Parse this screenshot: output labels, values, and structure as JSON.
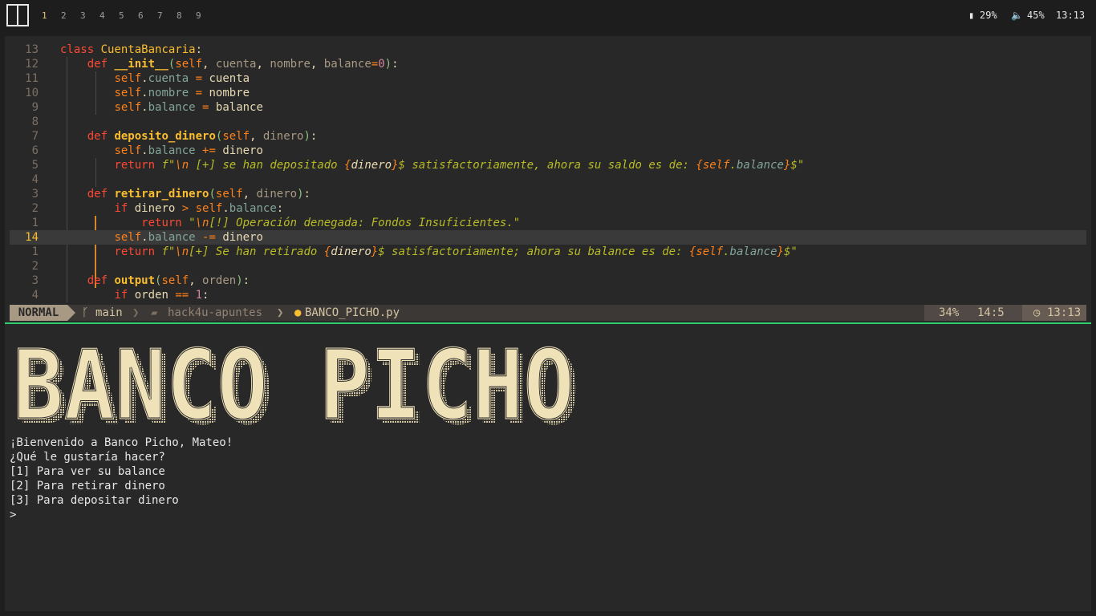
{
  "topbar": {
    "workspaces": [
      "1",
      "2",
      "3",
      "4",
      "5",
      "6",
      "7",
      "8",
      "9"
    ],
    "active_workspace": "1",
    "battery": "29%",
    "volume": "45%",
    "clock": "13:13"
  },
  "editor": {
    "lines": [
      {
        "num": "13",
        "html": "<span class=\"kw\">class</span> <span class=\"cls\">CuentaBancaria</span>:"
      },
      {
        "num": "12",
        "html": "    <span class=\"kw\">def</span> <span class=\"fn\">__init__</span><span class=\"par\">(</span><span class=\"self\">self</span>, <span class=\"param\">cuenta</span>, <span class=\"param\">nombre</span>, <span class=\"param\">balance</span><span class=\"op\">=</span><span class=\"num\">0</span><span class=\"par\">)</span>:"
      },
      {
        "num": "11",
        "html": "        <span class=\"self\">self</span>.<span class=\"attr\">cuenta</span> <span class=\"op\">=</span> cuenta"
      },
      {
        "num": "10",
        "html": "        <span class=\"self\">self</span>.<span class=\"attr\">nombre</span> <span class=\"op\">=</span> nombre"
      },
      {
        "num": "9",
        "html": "        <span class=\"self\">self</span>.<span class=\"attr\">balance</span> <span class=\"op\">=</span> balance"
      },
      {
        "num": "8",
        "html": ""
      },
      {
        "num": "7",
        "html": "    <span class=\"kw\">def</span> <span class=\"fn\">deposito_dinero</span><span class=\"par\">(</span><span class=\"self\">self</span>, <span class=\"param\">dinero</span><span class=\"par\">)</span>:"
      },
      {
        "num": "6",
        "html": "        <span class=\"self\">self</span>.<span class=\"attr\">balance</span> <span class=\"op\">+=</span> dinero"
      },
      {
        "num": "5",
        "html": "        <span class=\"kw\">return</span> <span class=\"str\">f\"<span class=\"esc\">\\n</span> [+] se han depositado <span class=\"brace\">{</span><span class=\"ivar\">dinero</span><span class=\"brace\">}</span>$ satisfactoriamente, ahora su saldo es de: <span class=\"brace\">{</span><span class=\"self\">self</span>.<span class=\"attr\">balance</span><span class=\"brace\">}</span>$\"</span>"
      },
      {
        "num": "4",
        "html": ""
      },
      {
        "num": "3",
        "html": "    <span class=\"kw\">def</span> <span class=\"fn\">retirar_dinero</span><span class=\"par\">(</span><span class=\"self\">self</span>, <span class=\"param\">dinero</span><span class=\"par\">)</span>:"
      },
      {
        "num": "2",
        "html": "        <span class=\"kw\">if</span> dinero <span class=\"op\">&gt;</span> <span class=\"self\">self</span>.<span class=\"attr\">balance</span>:"
      },
      {
        "num": "1",
        "html": "            <span class=\"kw\">return</span> <span class=\"str\">\"<span class=\"esc\">\\n</span>[!] Operación denegada: Fondos Insuficientes.\"</span>"
      },
      {
        "num": "14",
        "html": "        <span class=\"self\">self</span>.<span class=\"attr\">balance</span> <span class=\"op\">-=</span> dinero",
        "current": true
      },
      {
        "num": "1",
        "html": "        <span class=\"kw\">return</span> <span class=\"str\">f\"<span class=\"esc\">\\n</span>[+] Se han retirado <span class=\"brace\">{</span><span class=\"ivar\">dinero</span><span class=\"brace\">}</span>$ satisfactoriamente; ahora su balance es de: <span class=\"brace\">{</span><span class=\"self\">self</span>.<span class=\"attr\">balance</span><span class=\"brace\">}</span>$\"</span>"
      },
      {
        "num": "2",
        "html": ""
      },
      {
        "num": "3",
        "html": "    <span class=\"kw\">def</span> <span class=\"fn\">output</span><span class=\"par\">(</span><span class=\"self\">self</span>, <span class=\"param\">orden</span><span class=\"par\">)</span>:"
      },
      {
        "num": "4",
        "html": "        <span class=\"kw\">if</span> orden <span class=\"op\">==</span> <span class=\"num\">1</span>:"
      }
    ]
  },
  "statusline": {
    "mode": "NORMAL",
    "branch": "main",
    "folder": "hack4u-apuntes",
    "file": "BANCO_PICHO.py",
    "percent": "34%",
    "position": "14:5",
    "clock": "13:13"
  },
  "terminal": {
    "banner": "BANCO PICHO",
    "lines": [
      "¡Bienvenido a Banco Picho, Mateo!",
      "¿Qué le gustaría hacer?",
      "[1] Para ver su balance",
      "[2] Para retirar dinero",
      "[3] Para depositar dinero",
      ">"
    ]
  },
  "colors": {
    "divider": "#2fcf6f",
    "banner_fill": "#efe1b8",
    "accent": "#fabd2f"
  }
}
